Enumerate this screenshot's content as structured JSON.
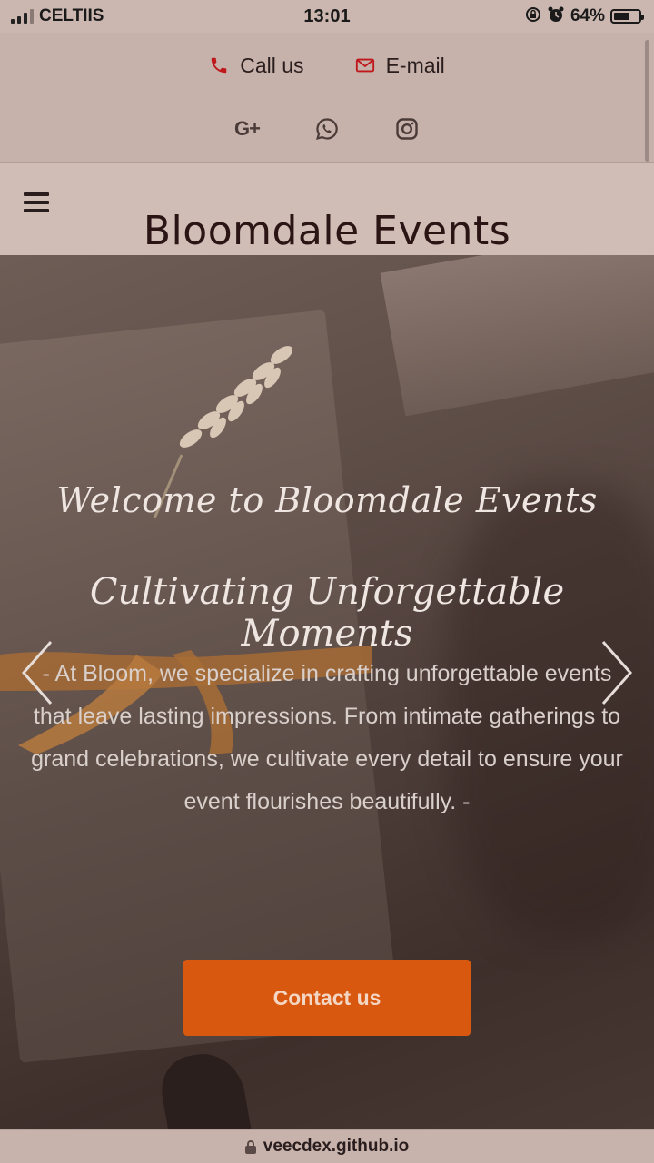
{
  "status_bar": {
    "carrier": "CELTIIS",
    "time": "13:01",
    "battery_percent": "64%",
    "battery_level": 0.64
  },
  "contact_bar": {
    "call_label": "Call us",
    "email_label": "E-mail",
    "socials": [
      "google-plus",
      "whatsapp",
      "instagram"
    ],
    "google_plus_label": "G+"
  },
  "header": {
    "brand": "Bloomdale Events"
  },
  "hero": {
    "welcome": "Welcome to Bloomdale Events",
    "tagline": "Cultivating Unforgettable Moments",
    "description": "- At Bloom, we specialize in crafting unforgettable events that leave lasting impressions. From intimate gatherings to grand celebrations, we cultivate every detail to ensure your event flourishes beautifully. -",
    "cta_label": "Contact us"
  },
  "url_bar": {
    "url": "veecdex.github.io"
  },
  "colors": {
    "accent_orange": "#d9580f",
    "icon_red": "#c0171b"
  }
}
